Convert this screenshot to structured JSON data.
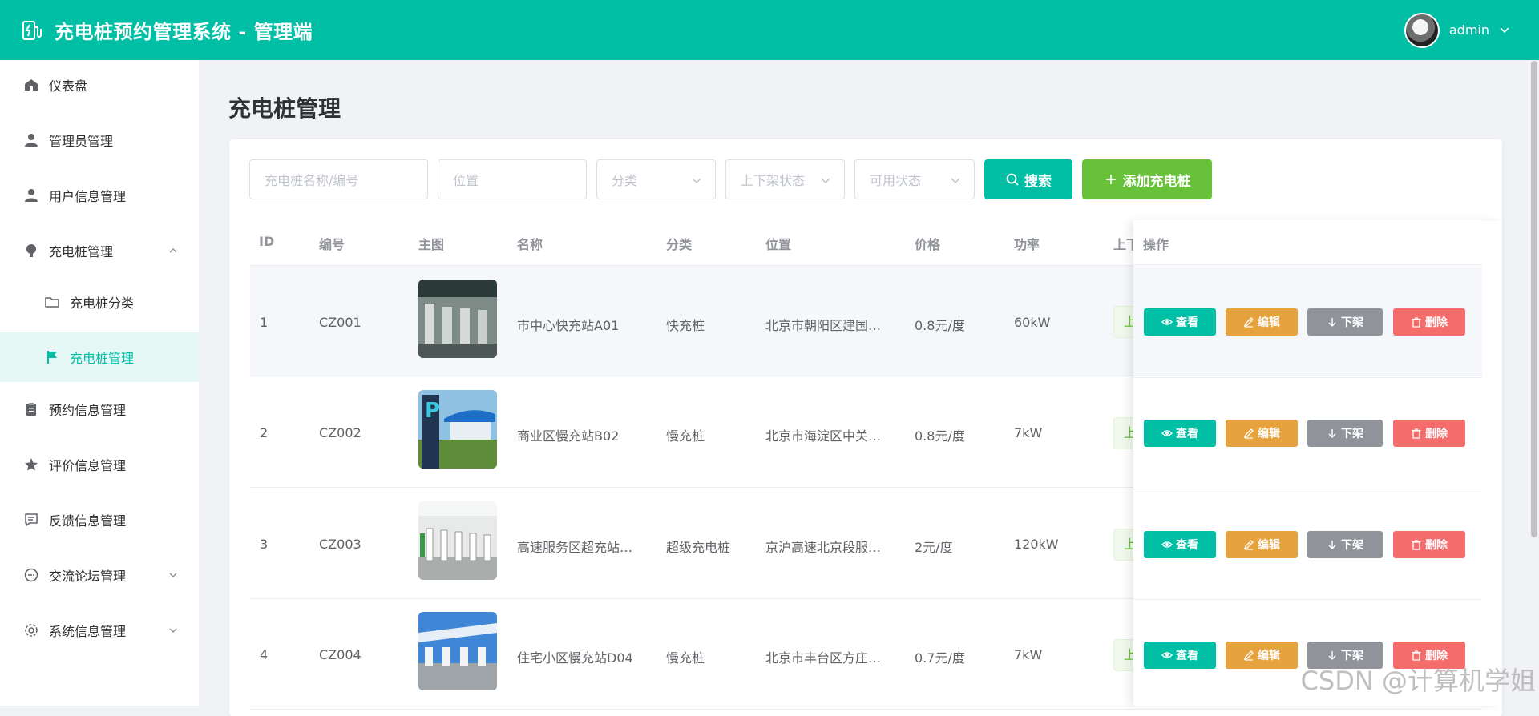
{
  "header": {
    "title": "充电桩预约管理系统 - 管理端",
    "username": "admin",
    "accent": "#00bfa5"
  },
  "sidebar": {
    "items": [
      {
        "label": "仪表盘",
        "icon": "home-icon"
      },
      {
        "label": "管理员管理",
        "icon": "user-icon"
      },
      {
        "label": "用户信息管理",
        "icon": "user-icon"
      },
      {
        "label": "充电桩管理",
        "icon": "bulb-icon",
        "expanded": true
      },
      {
        "label": "充电桩分类",
        "icon": "folder-icon",
        "sub": true
      },
      {
        "label": "充电桩管理",
        "icon": "flag-icon",
        "sub": true,
        "active": true
      },
      {
        "label": "预约信息管理",
        "icon": "clipboard-icon"
      },
      {
        "label": "评价信息管理",
        "icon": "star-icon"
      },
      {
        "label": "反馈信息管理",
        "icon": "message-icon"
      },
      {
        "label": "交流论坛管理",
        "icon": "chat-icon"
      },
      {
        "label": "系统信息管理",
        "icon": "gear-icon"
      }
    ]
  },
  "page": {
    "title": "充电桩管理"
  },
  "filters": {
    "name_placeholder": "充电桩名称/编号",
    "location_placeholder": "位置",
    "category_placeholder": "分类",
    "shelf_placeholder": "上下架状态",
    "available_placeholder": "可用状态",
    "search_label": "搜索",
    "add_label": "添加充电桩"
  },
  "table": {
    "columns": [
      "ID",
      "编号",
      "主图",
      "名称",
      "分类",
      "位置",
      "价格",
      "功率",
      "上下",
      "操作"
    ],
    "rows": [
      {
        "id": "1",
        "code": "CZ001",
        "name": "市中心快充站A01",
        "category": "快充桩",
        "location": "北京市朝阳区建国…",
        "price": "0.8元/度",
        "power": "60kW",
        "status": "上"
      },
      {
        "id": "2",
        "code": "CZ002",
        "name": "商业区慢充站B02",
        "category": "慢充桩",
        "location": "北京市海淀区中关…",
        "price": "0.8元/度",
        "power": "7kW",
        "status": "上"
      },
      {
        "id": "3",
        "code": "CZ003",
        "name": "高速服务区超充站…",
        "category": "超级充电桩",
        "location": "京沪高速北京段服…",
        "price": "2元/度",
        "power": "120kW",
        "status": "上"
      },
      {
        "id": "4",
        "code": "CZ004",
        "name": "住宅小区慢充站D04",
        "category": "慢充桩",
        "location": "北京市丰台区方庄…",
        "price": "0.7元/度",
        "power": "7kW",
        "status": "上"
      }
    ],
    "actions": {
      "view": "查看",
      "edit": "编辑",
      "down": "下架",
      "delete": "删除"
    }
  },
  "watermark": "CSDN @计算机学姐"
}
